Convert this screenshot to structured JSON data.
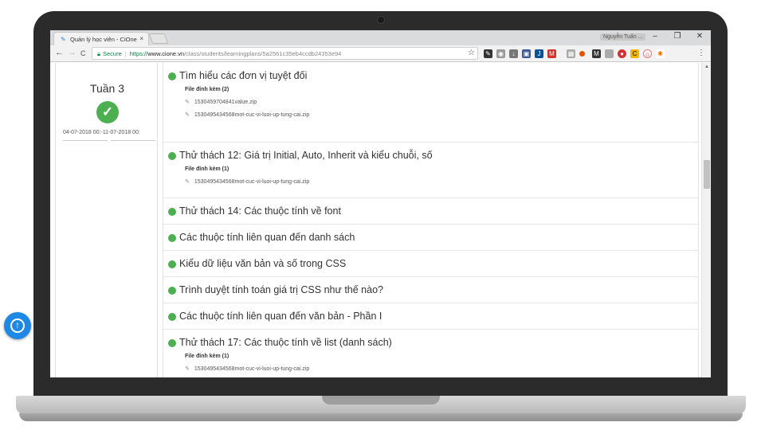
{
  "browser": {
    "tab_title": "Quản lý học viên - CiOne",
    "tab_close": "×",
    "user_name": "Nguyễn Tuấn ...",
    "secure_label": "Secure",
    "url_scheme": "https://",
    "url_host": "www.cione.vn",
    "url_path": "/class/students/learningplans/5a2561c35eb4ccdb24353e94",
    "back": "←",
    "forward": "→",
    "reload": "C",
    "minimize": "–",
    "maximize": "❐",
    "close": "✕",
    "star": "☆",
    "menu": "⋮"
  },
  "sidebar": {
    "week_label": "Tuần 3",
    "status_icon": "check-circle-icon",
    "date_range": "04-07-2018 00:-11-07-2018 00:"
  },
  "lessons": [
    {
      "title": "Tìm hiểu các đơn vị tuyệt đối",
      "attachments_label": "File đính kèm (2)",
      "files": [
        "1530459704841value.zip",
        "1530495434568mot-cuc-vi-luoi-up-tung-cai.zip"
      ]
    },
    {
      "title": "Thử thách 12: Giá trị Initial, Auto, Inherit và kiểu chuỗi, số",
      "attachments_label": "File đính kèm (1)",
      "files": [
        "1530495434568mot-cuc-vi-luoi-up-tung-cai.zip"
      ]
    },
    {
      "title": "Thử thách 14: Các thuộc tính về font"
    },
    {
      "title": "Các thuộc tính liên quan đến danh sách"
    },
    {
      "title": "Kiểu dữ liệu văn bản và số trong CSS"
    },
    {
      "title": "Trình duyệt tính toán giá trị CSS như thế nào?"
    },
    {
      "title": "Các thuộc tính liên quan đến văn bản - Phần I"
    },
    {
      "title": "Thử thách 17: Các thuộc tính về list (danh sách)",
      "attachments_label": "File đính kèm (1)",
      "files": [
        "1530495434568mot-cuc-vi-luoi-up-tung-cai.zip"
      ]
    }
  ],
  "colors": {
    "accent_green": "#4caf50",
    "fab_blue": "#1e88e5"
  },
  "scroll_to_top_icon": "arrow-up-circle-icon"
}
